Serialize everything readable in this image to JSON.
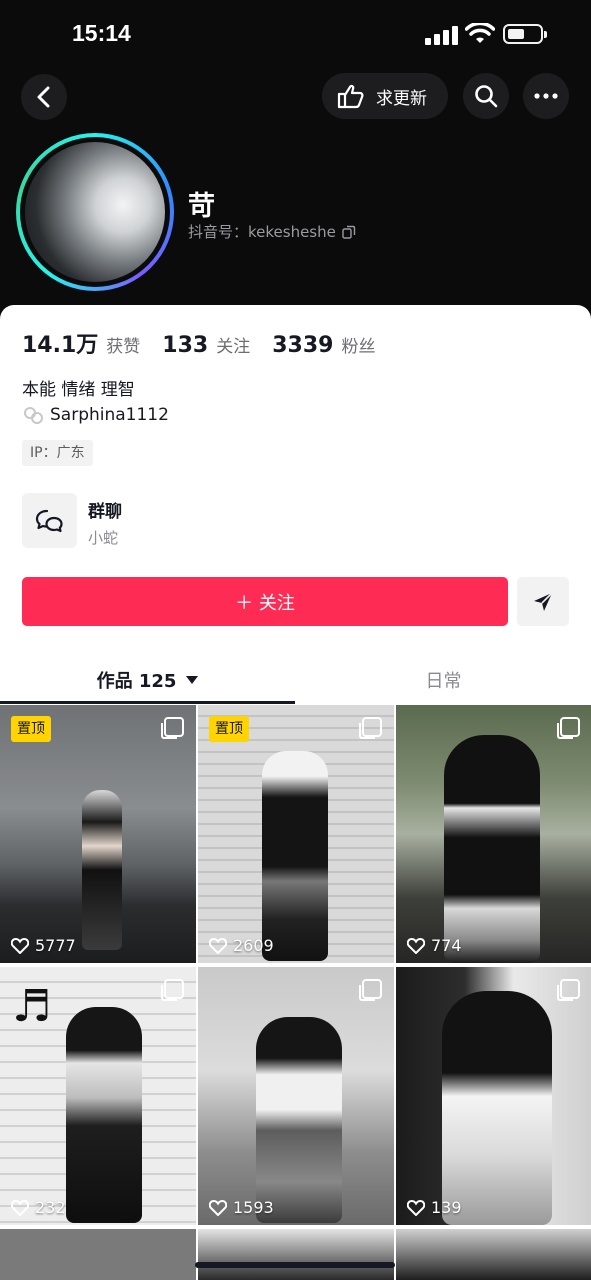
{
  "status": {
    "time": "15:14"
  },
  "nav": {
    "update_label": "求更新"
  },
  "profile": {
    "nickname": "苛",
    "douyin_id": "抖音号：kekesheshe"
  },
  "stats": [
    {
      "num": "14.1万",
      "label": "获赞"
    },
    {
      "num": "133",
      "label": "关注"
    },
    {
      "num": "3339",
      "label": "粉丝"
    }
  ],
  "bio": {
    "line1": "本能 情绪 理智",
    "handle": "Sarphina1112",
    "ip": "IP：广东"
  },
  "group": {
    "title": "群聊",
    "subtitle": "小蛇"
  },
  "actions": {
    "follow_label": "＋ 关注"
  },
  "tabs": {
    "works": "作品 125",
    "daily": "日常"
  },
  "grid": [
    {
      "likes": "5777",
      "pinned": "置顶",
      "multi": true
    },
    {
      "likes": "2609",
      "pinned": "置顶",
      "multi": true
    },
    {
      "likes": "774",
      "pinned": "",
      "multi": true
    },
    {
      "likes": "232",
      "pinned": "",
      "multi": true
    },
    {
      "likes": "1593",
      "pinned": "",
      "multi": true
    },
    {
      "likes": "139",
      "pinned": "",
      "multi": true
    }
  ],
  "colors": {
    "accent": "#fe2c55",
    "pin": "#ffd400",
    "ring": "#25f4ee"
  }
}
